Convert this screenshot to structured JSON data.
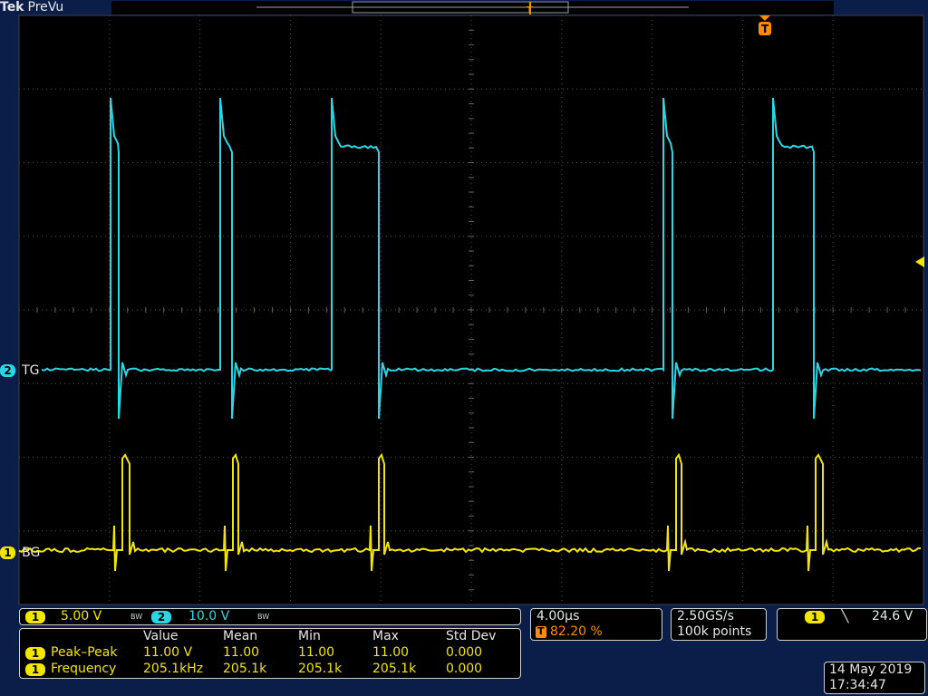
{
  "header": {
    "brand": "Tek",
    "mode": "PreVu"
  },
  "colors": {
    "ch1": "#f2e600",
    "ch2": "#28d7e6",
    "trigger": "#ff8c00"
  },
  "channels": [
    {
      "number": "1",
      "label": "BG"
    },
    {
      "number": "2",
      "label": "TG"
    }
  ],
  "vertical": {
    "ch1_scale": "5.00 V",
    "ch2_scale": "10.0 V",
    "bw_mark": "BW"
  },
  "measurements": {
    "headers": [
      "Value",
      "Mean",
      "Min",
      "Max",
      "Std Dev"
    ],
    "rows": [
      {
        "channel": "1",
        "name": "Peak–Peak",
        "value": "11.00 V",
        "mean": "11.00",
        "min": "11.00",
        "max": "11.00",
        "std": "0.000"
      },
      {
        "channel": "1",
        "name": "Frequency",
        "value": "205.1kHz",
        "mean": "205.1k",
        "min": "205.1k",
        "max": "205.1k",
        "std": "0.000"
      }
    ]
  },
  "horizontal": {
    "scale": "4.00µs",
    "trigger_marker": "T",
    "position": "82.20 %"
  },
  "acquisition": {
    "rate": "2.50GS/s",
    "points": "100k points"
  },
  "trigger": {
    "channel": "1",
    "slope_icon": "falling-edge-icon",
    "slope": "╲",
    "level": "24.6 V"
  },
  "datetime": {
    "date": "14 May 2019",
    "time": "17:34:47"
  },
  "markers": {
    "trigger_top": "T",
    "trigger_small": "T"
  }
}
